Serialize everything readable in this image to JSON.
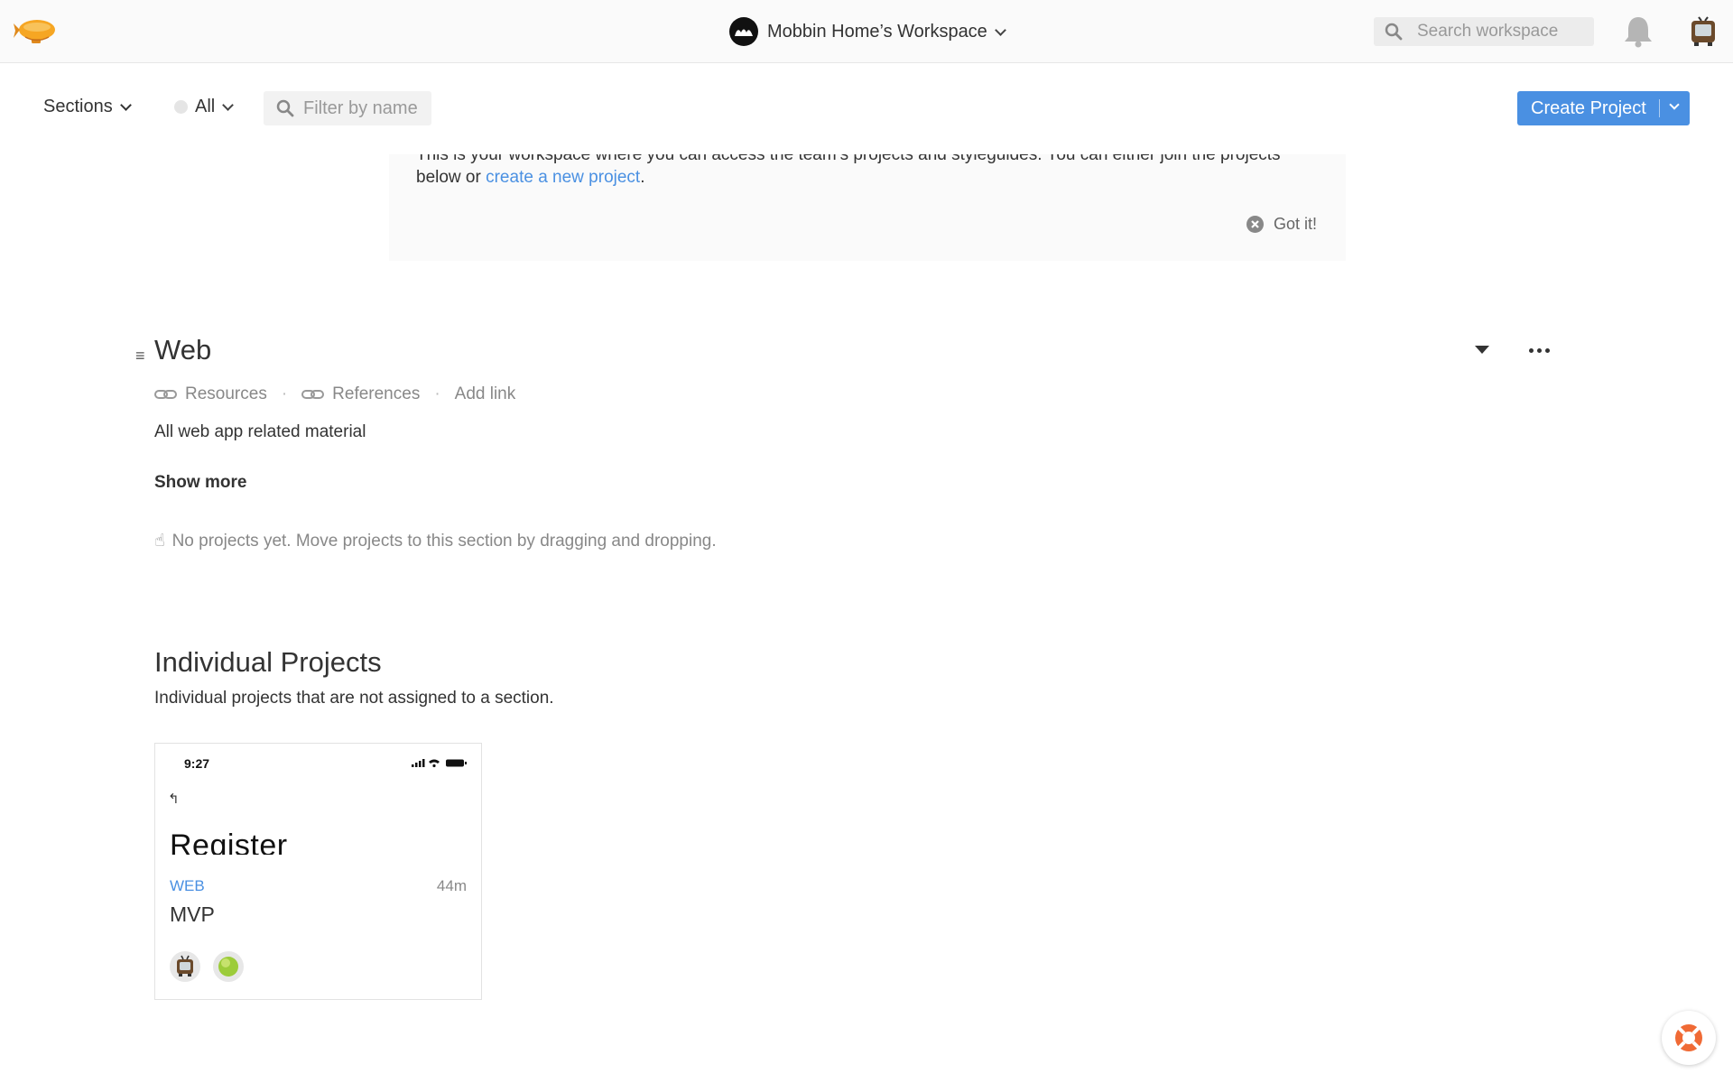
{
  "header": {
    "logo_icon": "zeppelin-icon",
    "workspace_name": "Mobbin Home’s Workspace",
    "search_placeholder": "Search workspace",
    "bell_icon": "bell-icon",
    "user_icon": "tv-avatar-icon"
  },
  "filters": {
    "sections_label": "Sections",
    "status_label": "All",
    "filter_placeholder": "Filter by name",
    "create_label": "Create Project"
  },
  "welcome": {
    "text_before": "This is your workspace where you can access the team’s projects and styleguides. You can either join the projects below or ",
    "link_text": "create a new project",
    "text_after": ".",
    "dismiss_label": "Got it!"
  },
  "section": {
    "drag_glyph": "≡",
    "title": "Web",
    "links": [
      {
        "label": "Resources"
      },
      {
        "label": "References"
      }
    ],
    "separator": "·",
    "add_link_label": "Add link",
    "description": "All web app related material",
    "show_more_label": "Show more",
    "empty_emoji": "☝",
    "empty_text": "No projects yet. Move projects to this section by dragging and dropping."
  },
  "individual": {
    "title": "Individual Projects",
    "description": "Individual projects that are not assigned to a section.",
    "projects": [
      {
        "thumb_time": "9:27",
        "thumb_back": "↰",
        "thumb_heading": "Register",
        "tag": "WEB",
        "age": "44m",
        "name": "MVP"
      }
    ]
  },
  "colors": {
    "accent": "#4a90e2",
    "topbar_bg": "#fafafa",
    "help_orange": "#f06a35"
  }
}
